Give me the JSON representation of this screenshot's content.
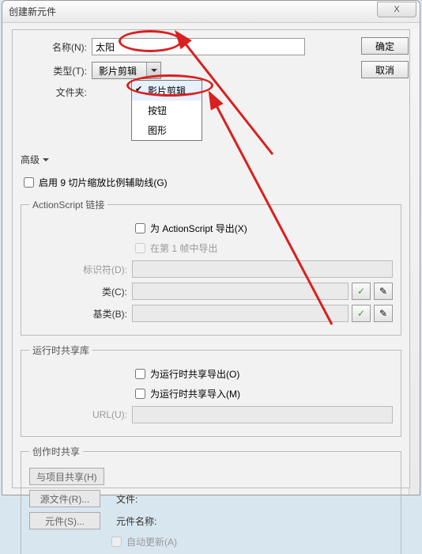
{
  "window": {
    "title": "创建新元件",
    "close_x": "X"
  },
  "buttons": {
    "ok": "确定",
    "cancel": "取消"
  },
  "labels": {
    "name": "名称(N):",
    "type": "类型(T):",
    "folder": "文件夹:",
    "advanced": "高级",
    "enable9slice": "启用 9 切片缩放比例辅助线(G)",
    "as_legend": "ActionScript 链接",
    "export_as": "为 ActionScript 导出(X)",
    "export_frame1": "在第 1 帧中导出",
    "identifier": "标识符(D):",
    "class": "类(C):",
    "baseclass": "基类(B):",
    "runtime_legend": "运行时共享库",
    "export_runtime": "为运行时共享导出(O)",
    "import_runtime": "为运行时共享导入(M)",
    "url": "URL(U):",
    "author_legend": "创作时共享",
    "share_proj": "与项目共享(H)",
    "src_file": "源文件(R)...",
    "file_lbl": "文件:",
    "symbol_btn": "元件(S)...",
    "symbol_name_lbl": "元件名称:",
    "auto_update": "自动更新(A)"
  },
  "values": {
    "name": "太阳",
    "type_selected": "影片剪辑"
  },
  "dropdown": {
    "items": [
      "影片剪辑",
      "按钮",
      "图形"
    ],
    "selected_index": 0
  },
  "icons": {
    "check_green": "✓",
    "pencil": "✎"
  },
  "annotations": {
    "oval_name": true,
    "oval_dropdown": true,
    "arrows": true
  }
}
